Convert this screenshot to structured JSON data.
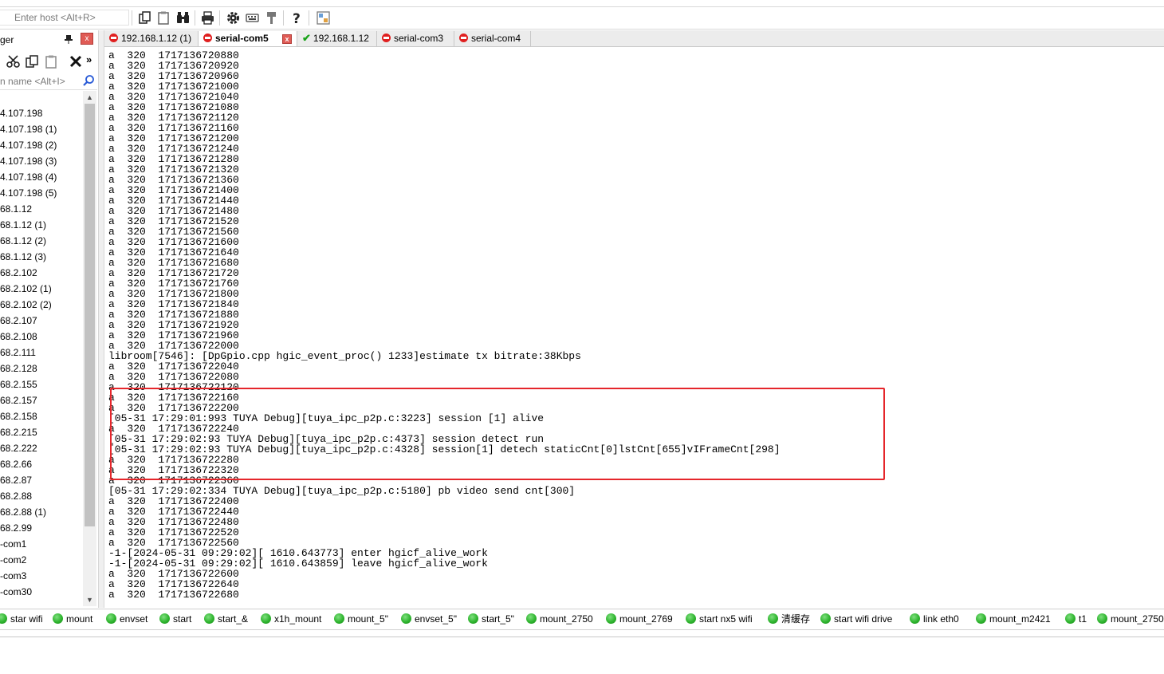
{
  "toolbar": {
    "host_placeholder": "Enter host <Alt+R>",
    "icons": [
      "copy-icon",
      "paste-icon",
      "find-icon",
      "print-icon",
      "settings-icon",
      "keymap-icon",
      "key-icon",
      "help-icon",
      "screen-icon"
    ]
  },
  "session_panel": {
    "title": "ger",
    "close_label": "x",
    "search_placeholder": "n name <Alt+I>",
    "more_label": "»",
    "items": [
      "4.107.198",
      "4.107.198 (1)",
      "4.107.198 (2)",
      "4.107.198 (3)",
      "4.107.198 (4)",
      "4.107.198 (5)",
      "68.1.12",
      "68.1.12 (1)",
      "68.1.12 (2)",
      "68.1.12 (3)",
      "68.2.102",
      "68.2.102 (1)",
      "68.2.102 (2)",
      "68.2.107",
      "68.2.108",
      "68.2.111",
      "68.2.128",
      "68.2.155",
      "68.2.157",
      "68.2.158",
      "68.2.215",
      "68.2.222",
      "68.2.66",
      "68.2.87",
      "68.2.88",
      "68.2.88 (1)",
      "68.2.99",
      "-com1",
      "-com2",
      "-com3",
      "-com30"
    ]
  },
  "tabs": [
    {
      "label": "192.168.1.12 (1)",
      "status": "disconnected",
      "active": false
    },
    {
      "label": "serial-com5",
      "status": "disconnected",
      "active": true
    },
    {
      "label": "192.168.1.12",
      "status": "connected",
      "active": false
    },
    {
      "label": "serial-com3",
      "status": "disconnected",
      "active": false
    },
    {
      "label": "serial-com4",
      "status": "disconnected",
      "active": false
    }
  ],
  "tab_close_label": "x",
  "terminal": {
    "lines": [
      "a  320  1717136720880",
      "a  320  1717136720920",
      "a  320  1717136720960",
      "a  320  1717136721000",
      "a  320  1717136721040",
      "a  320  1717136721080",
      "a  320  1717136721120",
      "a  320  1717136721160",
      "a  320  1717136721200",
      "a  320  1717136721240",
      "a  320  1717136721280",
      "a  320  1717136721320",
      "a  320  1717136721360",
      "a  320  1717136721400",
      "a  320  1717136721440",
      "a  320  1717136721480",
      "a  320  1717136721520",
      "a  320  1717136721560",
      "a  320  1717136721600",
      "a  320  1717136721640",
      "a  320  1717136721680",
      "a  320  1717136721720",
      "a  320  1717136721760",
      "a  320  1717136721800",
      "a  320  1717136721840",
      "a  320  1717136721880",
      "a  320  1717136721920",
      "a  320  1717136721960",
      "a  320  1717136722000",
      "libroom[7546]: [DpGpio.cpp hgic_event_proc() 1233]estimate tx bitrate:38Kbps",
      "a  320  1717136722040",
      "a  320  1717136722080",
      "a  320  1717136722120",
      "a  320  1717136722160",
      "a  320  1717136722200",
      "[05-31 17:29:01:993 TUYA Debug][tuya_ipc_p2p.c:3223] session [1] alive",
      "a  320  1717136722240",
      "[05-31 17:29:02:93 TUYA Debug][tuya_ipc_p2p.c:4373] session detect run",
      "[05-31 17:29:02:93 TUYA Debug][tuya_ipc_p2p.c:4328] session[1] detech staticCnt[0]lstCnt[655]vIFrameCnt[298]",
      "a  320  1717136722280",
      "a  320  1717136722320",
      "a  320  1717136722360",
      "[05-31 17:29:02:334 TUYA Debug][tuya_ipc_p2p.c:5180] pb video send cnt[300]",
      "a  320  1717136722400",
      "a  320  1717136722440",
      "a  320  1717136722480",
      "a  320  1717136722520",
      "a  320  1717136722560",
      "-1-[2024-05-31 09:29:02][ 1610.643773] enter hgicf_alive_work",
      "-1-[2024-05-31 09:29:02][ 1610.643859] leave hgicf_alive_work",
      "a  320  1717136722600",
      "a  320  1717136722640",
      "a  320  1717136722680"
    ]
  },
  "macros": [
    "star wifi",
    "mount",
    "envset",
    "start",
    "start_&",
    "x1h_mount",
    "mount_5\"",
    "envset_5\"",
    "start_5\"",
    "mount_2750",
    "mount_2769",
    "start nx5 wifi",
    "清缓存",
    "start wifi drive",
    "link eth0",
    "mount_m2421",
    "t1",
    "mount_2750"
  ],
  "colors": {
    "highlight": "#e5262b",
    "connected": "#1aa31a",
    "disconnected": "#e02020",
    "macro_dot": "#2fb52f"
  }
}
